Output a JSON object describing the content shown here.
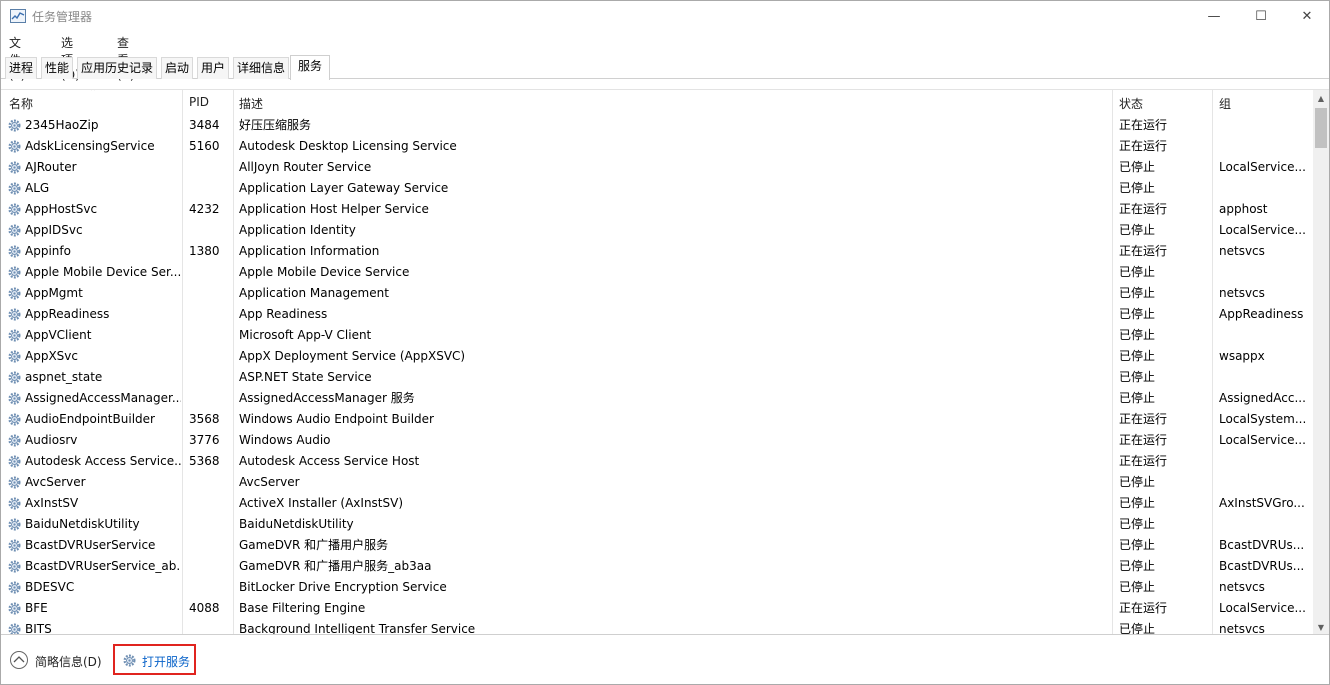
{
  "window": {
    "title": "任务管理器",
    "controls": {
      "minimize": "—",
      "maximize": "☐",
      "close": "✕"
    }
  },
  "menu": [
    "文件(F)",
    "选项(O)",
    "查看(V)"
  ],
  "tabs": [
    "进程",
    "性能",
    "应用历史记录",
    "启动",
    "用户",
    "详细信息",
    "服务"
  ],
  "active_tab": "服务",
  "columns": {
    "name": "名称",
    "pid": "PID",
    "description": "描述",
    "status": "状态",
    "group": "组"
  },
  "rows": [
    {
      "name": "2345HaoZip",
      "pid": "3484",
      "description": "好压压缩服务",
      "status": "正在运行",
      "group": ""
    },
    {
      "name": "AdskLicensingService",
      "pid": "5160",
      "description": "Autodesk Desktop Licensing Service",
      "status": "正在运行",
      "group": ""
    },
    {
      "name": "AJRouter",
      "pid": "",
      "description": "AllJoyn Router Service",
      "status": "已停止",
      "group": "LocalService..."
    },
    {
      "name": "ALG",
      "pid": "",
      "description": "Application Layer Gateway Service",
      "status": "已停止",
      "group": ""
    },
    {
      "name": "AppHostSvc",
      "pid": "4232",
      "description": "Application Host Helper Service",
      "status": "正在运行",
      "group": "apphost"
    },
    {
      "name": "AppIDSvc",
      "pid": "",
      "description": "Application Identity",
      "status": "已停止",
      "group": "LocalService..."
    },
    {
      "name": "Appinfo",
      "pid": "1380",
      "description": "Application Information",
      "status": "正在运行",
      "group": "netsvcs"
    },
    {
      "name": "Apple Mobile Device Ser...",
      "pid": "",
      "description": "Apple Mobile Device Service",
      "status": "已停止",
      "group": ""
    },
    {
      "name": "AppMgmt",
      "pid": "",
      "description": "Application Management",
      "status": "已停止",
      "group": "netsvcs"
    },
    {
      "name": "AppReadiness",
      "pid": "",
      "description": "App Readiness",
      "status": "已停止",
      "group": "AppReadiness"
    },
    {
      "name": "AppVClient",
      "pid": "",
      "description": "Microsoft App-V Client",
      "status": "已停止",
      "group": ""
    },
    {
      "name": "AppXSvc",
      "pid": "",
      "description": "AppX Deployment Service (AppXSVC)",
      "status": "已停止",
      "group": "wsappx"
    },
    {
      "name": "aspnet_state",
      "pid": "",
      "description": "ASP.NET State Service",
      "status": "已停止",
      "group": ""
    },
    {
      "name": "AssignedAccessManager...",
      "pid": "",
      "description": "AssignedAccessManager 服务",
      "status": "已停止",
      "group": "AssignedAcc..."
    },
    {
      "name": "AudioEndpointBuilder",
      "pid": "3568",
      "description": "Windows Audio Endpoint Builder",
      "status": "正在运行",
      "group": "LocalSystem..."
    },
    {
      "name": "Audiosrv",
      "pid": "3776",
      "description": "Windows Audio",
      "status": "正在运行",
      "group": "LocalService..."
    },
    {
      "name": "Autodesk Access Service...",
      "pid": "5368",
      "description": "Autodesk Access Service Host",
      "status": "正在运行",
      "group": ""
    },
    {
      "name": "AvcServer",
      "pid": "",
      "description": "AvcServer",
      "status": "已停止",
      "group": ""
    },
    {
      "name": "AxInstSV",
      "pid": "",
      "description": "ActiveX Installer (AxInstSV)",
      "status": "已停止",
      "group": "AxInstSVGro..."
    },
    {
      "name": "BaiduNetdiskUtility",
      "pid": "",
      "description": "BaiduNetdiskUtility",
      "status": "已停止",
      "group": ""
    },
    {
      "name": "BcastDVRUserService",
      "pid": "",
      "description": "GameDVR 和广播用户服务",
      "status": "已停止",
      "group": "BcastDVRUs..."
    },
    {
      "name": "BcastDVRUserService_ab...",
      "pid": "",
      "description": "GameDVR 和广播用户服务_ab3aa",
      "status": "已停止",
      "group": "BcastDVRUs..."
    },
    {
      "name": "BDESVC",
      "pid": "",
      "description": "BitLocker Drive Encryption Service",
      "status": "已停止",
      "group": "netsvcs"
    },
    {
      "name": "BFE",
      "pid": "4088",
      "description": "Base Filtering Engine",
      "status": "正在运行",
      "group": "LocalService..."
    },
    {
      "name": "BITS",
      "pid": "",
      "description": "Background Intelligent Transfer Service",
      "status": "已停止",
      "group": "netsvcs"
    }
  ],
  "footer": {
    "fewer_details": "简略信息(D)",
    "open_services": "打开服务"
  }
}
